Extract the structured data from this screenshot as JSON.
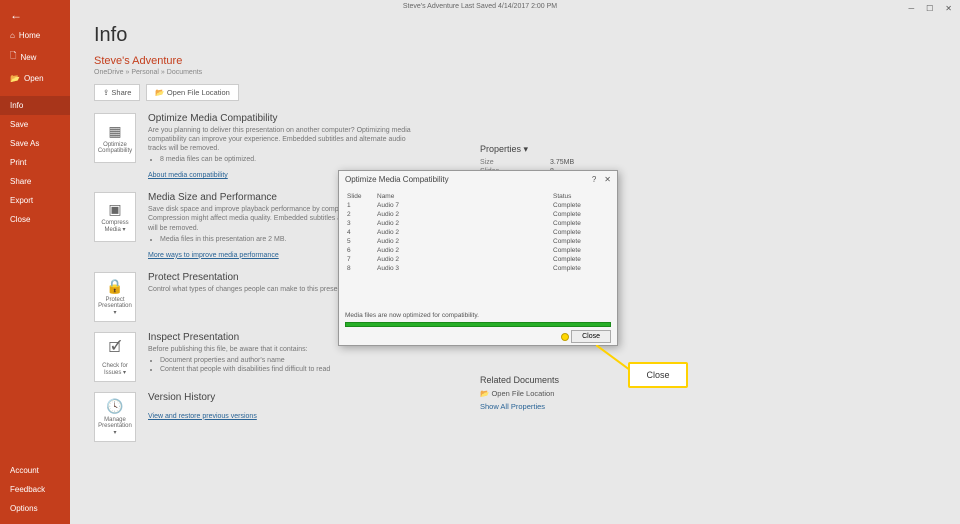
{
  "titlebar": {
    "text": "Steve's Adventure    Last Saved 4/14/2017 2:00 PM"
  },
  "sidebar": {
    "back_icon": "←",
    "items": [
      {
        "icon": "⌂",
        "label": "Home"
      },
      {
        "icon": "🗋",
        "label": "New"
      },
      {
        "icon": "📂",
        "label": "Open"
      }
    ],
    "section2": [
      {
        "label": "Info",
        "active": true
      },
      {
        "label": "Save"
      },
      {
        "label": "Save As"
      },
      {
        "label": "Print"
      },
      {
        "label": "Share"
      },
      {
        "label": "Export"
      },
      {
        "label": "Close"
      }
    ],
    "bottom": [
      {
        "label": "Account"
      },
      {
        "label": "Feedback"
      },
      {
        "label": "Options"
      }
    ]
  },
  "page": {
    "title": "Info",
    "doc_title": "Steve's Adventure",
    "doc_path": "OneDrive » Personal » Documents",
    "share_btn": "Share",
    "open_loc_btn": "Open File Location"
  },
  "sections": {
    "optimize": {
      "tile": "Optimize Compatibility",
      "heading": "Optimize Media Compatibility",
      "desc": "Are you planning to deliver this presentation on another computer? Optimizing media compatibility can improve your experience. Embedded subtitles and alternate audio tracks will be removed.",
      "bullet": "8 media files can be optimized.",
      "link": "About media compatibility"
    },
    "compress": {
      "tile": "Compress Media ▾",
      "heading": "Media Size and Performance",
      "desc": "Save disk space and improve playback performance by compressing your media files. Compression might affect media quality. Embedded subtitles and alternate audio tracks will be removed.",
      "bullet": "Media files in this presentation are 2 MB.",
      "link": "More ways to improve media performance"
    },
    "protect": {
      "tile": "Protect Presentation ▾",
      "heading": "Protect Presentation",
      "desc": "Control what types of changes people can make to this presentation."
    },
    "inspect": {
      "tile": "Check for Issues ▾",
      "heading": "Inspect Presentation",
      "desc": "Before publishing this file, be aware that it contains:",
      "b1": "Document properties and author's name",
      "b2": "Content that people with disabilities find difficult to read"
    },
    "version": {
      "tile": "Manage Presentation ▾",
      "heading": "Version History",
      "link": "View and restore previous versions"
    }
  },
  "right": {
    "props_head": "Properties ▾",
    "size_label": "Size",
    "size_val": "3.75MB",
    "slides_label": "Slides",
    "slides_val": "8",
    "related_head": "Related Documents",
    "open_loc": "Open File Location",
    "show_all": "Show All Properties"
  },
  "dialog": {
    "title": "Optimize Media Compatibility",
    "col_slide": "Slide",
    "col_name": "Name",
    "col_status": "Status",
    "rows": [
      {
        "s": "1",
        "n": "Audio 7",
        "st": "Complete"
      },
      {
        "s": "2",
        "n": "Audio 2",
        "st": "Complete"
      },
      {
        "s": "3",
        "n": "Audio 2",
        "st": "Complete"
      },
      {
        "s": "4",
        "n": "Audio 2",
        "st": "Complete"
      },
      {
        "s": "5",
        "n": "Audio 2",
        "st": "Complete"
      },
      {
        "s": "6",
        "n": "Audio 2",
        "st": "Complete"
      },
      {
        "s": "7",
        "n": "Audio 2",
        "st": "Complete"
      },
      {
        "s": "8",
        "n": "Audio 3",
        "st": "Complete"
      }
    ],
    "status_text": "Media files are now optimized for compatibility.",
    "close": "Close"
  },
  "callout": {
    "label": "Close"
  }
}
